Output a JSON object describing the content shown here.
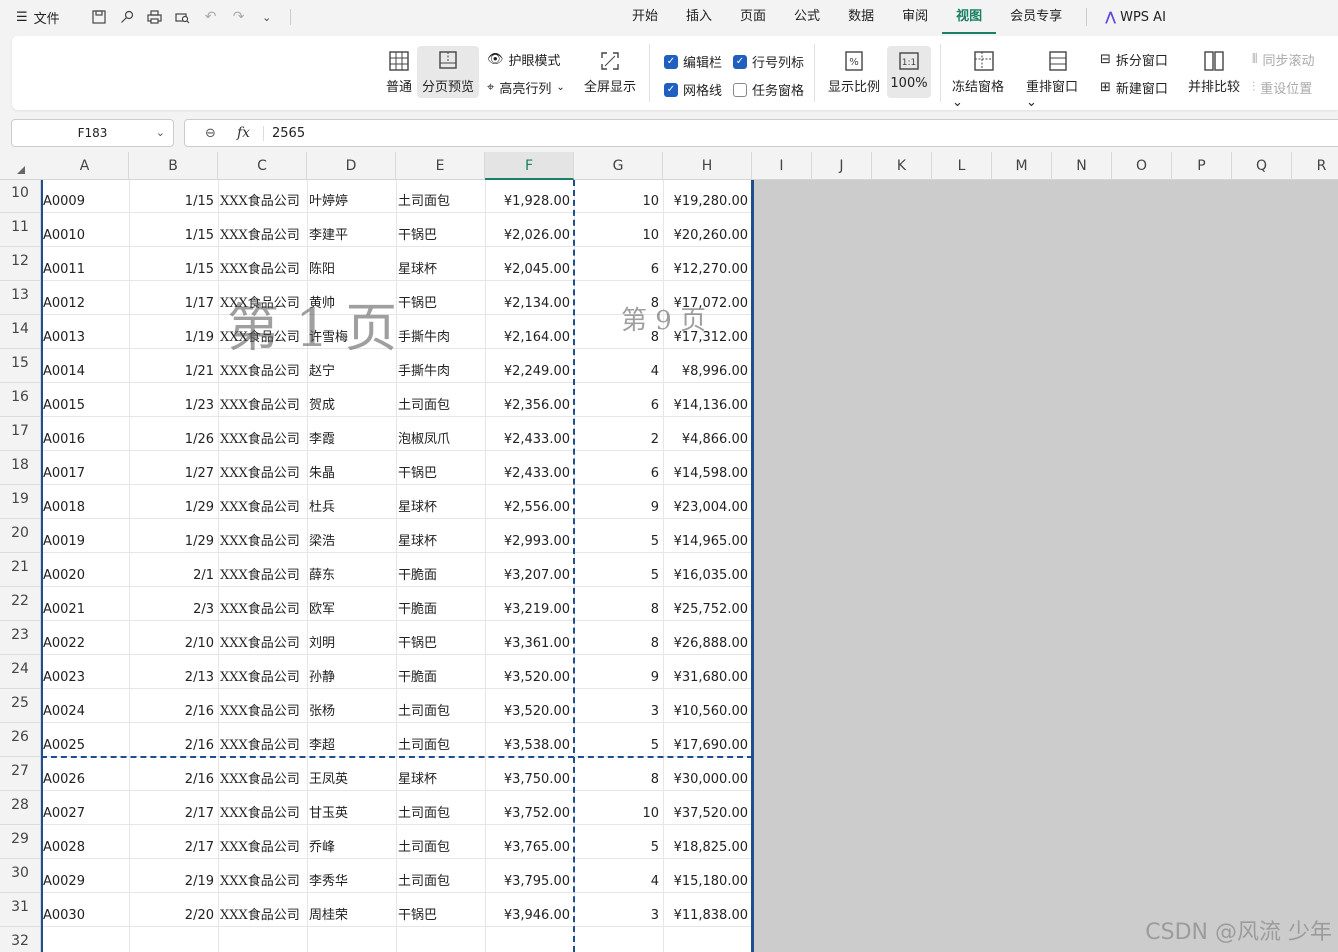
{
  "menu": {
    "file_label": "文件"
  },
  "tabs": [
    "开始",
    "插入",
    "页面",
    "公式",
    "数据",
    "审阅",
    "视图",
    "会员专享"
  ],
  "active_tab": "视图",
  "wps_ai": "WPS AI",
  "ribbon": {
    "normal": "普通",
    "page_break_preview": "分页预览",
    "eye_mode": "护眼模式",
    "highlight": "高亮行列",
    "fullscreen": "全屏显示",
    "formula_bar": "编辑栏",
    "headers": "行号列标",
    "gridlines": "网格线",
    "task_pane": "任务窗格",
    "zoom": "显示比例",
    "zoom100": "100%",
    "freeze": "冻结窗格",
    "rearrange": "重排窗口",
    "split": "拆分窗口",
    "new_window": "新建窗口",
    "side_by_side": "并排比较",
    "sync_scroll": "同步滚动",
    "reset_pos": "重设位置",
    "formula_bar_checked": true,
    "headers_checked": true,
    "gridlines_checked": true,
    "task_pane_checked": false
  },
  "name_box": "F183",
  "formula_value": "2565",
  "columns": [
    "A",
    "B",
    "C",
    "D",
    "E",
    "F",
    "G",
    "H",
    "I",
    "J",
    "K",
    "L",
    "M",
    "N",
    "O",
    "P",
    "Q",
    "R"
  ],
  "active_column": "F",
  "rows": [
    {
      "n": "10",
      "a": "A0009",
      "b": "1/15",
      "c": "XXX食品公司",
      "d": "叶婷婷",
      "e": "土司面包",
      "f": "¥1,928.00",
      "g": "10",
      "h": "¥19,280.00"
    },
    {
      "n": "11",
      "a": "A0010",
      "b": "1/15",
      "c": "XXX食品公司",
      "d": "李建平",
      "e": "干锅巴",
      "f": "¥2,026.00",
      "g": "10",
      "h": "¥20,260.00"
    },
    {
      "n": "12",
      "a": "A0011",
      "b": "1/15",
      "c": "XXX食品公司",
      "d": "陈阳",
      "e": "星球杯",
      "f": "¥2,045.00",
      "g": "6",
      "h": "¥12,270.00"
    },
    {
      "n": "13",
      "a": "A0012",
      "b": "1/17",
      "c": "XXX食品公司",
      "d": "黄帅",
      "e": "干锅巴",
      "f": "¥2,134.00",
      "g": "8",
      "h": "¥17,072.00"
    },
    {
      "n": "14",
      "a": "A0013",
      "b": "1/19",
      "c": "XXX食品公司",
      "d": "许雪梅",
      "e": "手撕牛肉",
      "f": "¥2,164.00",
      "g": "8",
      "h": "¥17,312.00"
    },
    {
      "n": "15",
      "a": "A0014",
      "b": "1/21",
      "c": "XXX食品公司",
      "d": "赵宁",
      "e": "手撕牛肉",
      "f": "¥2,249.00",
      "g": "4",
      "h": "¥8,996.00"
    },
    {
      "n": "16",
      "a": "A0015",
      "b": "1/23",
      "c": "XXX食品公司",
      "d": "贺成",
      "e": "土司面包",
      "f": "¥2,356.00",
      "g": "6",
      "h": "¥14,136.00"
    },
    {
      "n": "17",
      "a": "A0016",
      "b": "1/26",
      "c": "XXX食品公司",
      "d": "李霞",
      "e": "泡椒凤爪",
      "f": "¥2,433.00",
      "g": "2",
      "h": "¥4,866.00"
    },
    {
      "n": "18",
      "a": "A0017",
      "b": "1/27",
      "c": "XXX食品公司",
      "d": "朱晶",
      "e": "干锅巴",
      "f": "¥2,433.00",
      "g": "6",
      "h": "¥14,598.00"
    },
    {
      "n": "19",
      "a": "A0018",
      "b": "1/29",
      "c": "XXX食品公司",
      "d": "杜兵",
      "e": "星球杯",
      "f": "¥2,556.00",
      "g": "9",
      "h": "¥23,004.00"
    },
    {
      "n": "20",
      "a": "A0019",
      "b": "1/29",
      "c": "XXX食品公司",
      "d": "梁浩",
      "e": "星球杯",
      "f": "¥2,993.00",
      "g": "5",
      "h": "¥14,965.00"
    },
    {
      "n": "21",
      "a": "A0020",
      "b": "2/1",
      "c": "XXX食品公司",
      "d": "薛东",
      "e": "干脆面",
      "f": "¥3,207.00",
      "g": "5",
      "h": "¥16,035.00"
    },
    {
      "n": "22",
      "a": "A0021",
      "b": "2/3",
      "c": "XXX食品公司",
      "d": "欧军",
      "e": "干脆面",
      "f": "¥3,219.00",
      "g": "8",
      "h": "¥25,752.00"
    },
    {
      "n": "23",
      "a": "A0022",
      "b": "2/10",
      "c": "XXX食品公司",
      "d": "刘明",
      "e": "干锅巴",
      "f": "¥3,361.00",
      "g": "8",
      "h": "¥26,888.00"
    },
    {
      "n": "24",
      "a": "A0023",
      "b": "2/13",
      "c": "XXX食品公司",
      "d": "孙静",
      "e": "干脆面",
      "f": "¥3,520.00",
      "g": "9",
      "h": "¥31,680.00"
    },
    {
      "n": "25",
      "a": "A0024",
      "b": "2/16",
      "c": "XXX食品公司",
      "d": "张杨",
      "e": "土司面包",
      "f": "¥3,520.00",
      "g": "3",
      "h": "¥10,560.00"
    },
    {
      "n": "26",
      "a": "A0025",
      "b": "2/16",
      "c": "XXX食品公司",
      "d": "李超",
      "e": "土司面包",
      "f": "¥3,538.00",
      "g": "5",
      "h": "¥17,690.00"
    },
    {
      "n": "27",
      "a": "A0026",
      "b": "2/16",
      "c": "XXX食品公司",
      "d": "王凤英",
      "e": "星球杯",
      "f": "¥3,750.00",
      "g": "8",
      "h": "¥30,000.00"
    },
    {
      "n": "28",
      "a": "A0027",
      "b": "2/17",
      "c": "XXX食品公司",
      "d": "甘玉英",
      "e": "土司面包",
      "f": "¥3,752.00",
      "g": "10",
      "h": "¥37,520.00"
    },
    {
      "n": "29",
      "a": "A0028",
      "b": "2/17",
      "c": "XXX食品公司",
      "d": "乔峰",
      "e": "土司面包",
      "f": "¥3,765.00",
      "g": "5",
      "h": "¥18,825.00"
    },
    {
      "n": "30",
      "a": "A0029",
      "b": "2/19",
      "c": "XXX食品公司",
      "d": "李秀华",
      "e": "土司面包",
      "f": "¥3,795.00",
      "g": "4",
      "h": "¥15,180.00"
    },
    {
      "n": "31",
      "a": "A0030",
      "b": "2/20",
      "c": "XXX食品公司",
      "d": "周桂荣",
      "e": "干锅巴",
      "f": "¥3,946.00",
      "g": "3",
      "h": "¥11,838.00"
    },
    {
      "n": "32",
      "a": "",
      "b": "",
      "c": "",
      "d": "",
      "e": "",
      "f": "",
      "g": "",
      "h": ""
    }
  ],
  "page_labels": [
    "第 1 页",
    "第 9 页"
  ],
  "watermark": "CSDN @风流 少年"
}
